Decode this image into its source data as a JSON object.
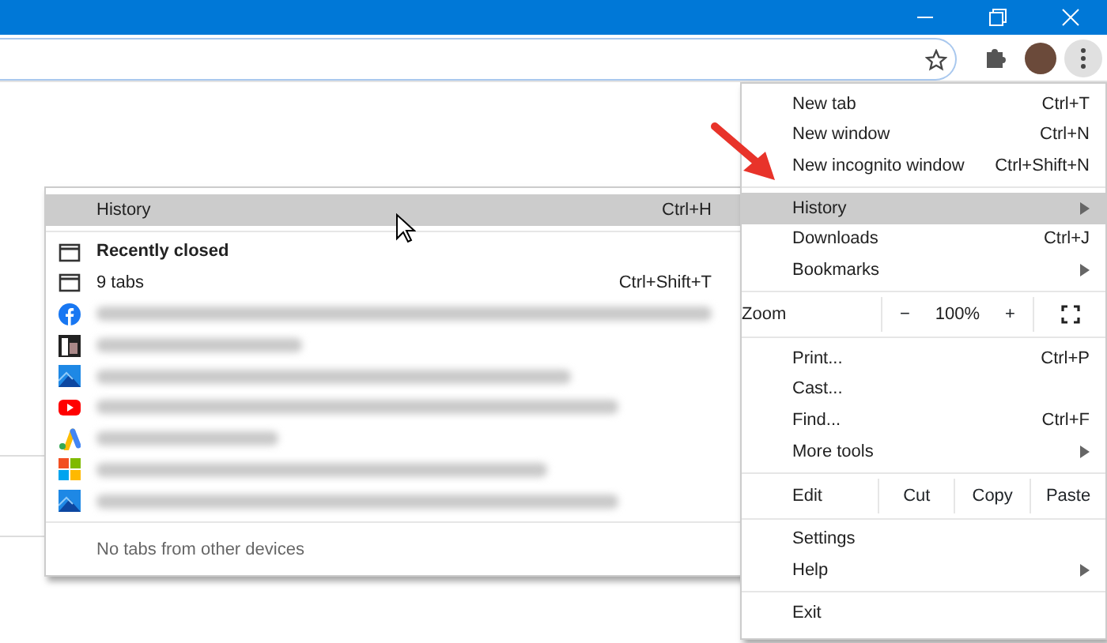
{
  "main_menu": {
    "groups": [
      [
        {
          "kind": "item",
          "label": "New tab",
          "shortcut": "Ctrl+T",
          "has_submenu": false,
          "selected": false
        },
        {
          "kind": "item",
          "label": "New window",
          "shortcut": "Ctrl+N",
          "has_submenu": false,
          "selected": false
        },
        {
          "kind": "item",
          "label": "New incognito window",
          "shortcut": "Ctrl+Shift+N",
          "has_submenu": false,
          "selected": false
        }
      ],
      [
        {
          "kind": "item",
          "label": "History",
          "has_submenu": true,
          "selected": true
        },
        {
          "kind": "item",
          "label": "Downloads",
          "shortcut": "Ctrl+J",
          "has_submenu": false,
          "selected": false
        },
        {
          "kind": "item",
          "label": "Bookmarks",
          "has_submenu": true,
          "selected": false
        }
      ],
      [
        {
          "kind": "zoom",
          "label": "Zoom",
          "minus": "−",
          "value": "100%",
          "plus": "+"
        }
      ],
      [
        {
          "kind": "item",
          "label": "Print...",
          "shortcut": "Ctrl+P",
          "has_submenu": false,
          "selected": false
        },
        {
          "kind": "item",
          "label": "Cast...",
          "has_submenu": false,
          "selected": false
        },
        {
          "kind": "item",
          "label": "Find...",
          "shortcut": "Ctrl+F",
          "has_submenu": false,
          "selected": false
        },
        {
          "kind": "item",
          "label": "More tools",
          "has_submenu": true,
          "selected": false
        }
      ],
      [
        {
          "kind": "edit",
          "label": "Edit",
          "buttons": [
            "Cut",
            "Copy",
            "Paste"
          ]
        }
      ],
      [
        {
          "kind": "item",
          "label": "Settings",
          "has_submenu": false,
          "selected": false
        },
        {
          "kind": "item",
          "label": "Help",
          "has_submenu": true,
          "selected": false
        }
      ],
      [
        {
          "kind": "item",
          "label": "Exit",
          "has_submenu": false,
          "selected": false
        }
      ]
    ]
  },
  "history_submenu": {
    "header": {
      "label": "History",
      "shortcut": "Ctrl+H",
      "selected": true
    },
    "recently_closed": "Recently closed",
    "entries": [
      {
        "kind": "window",
        "label": "9 tabs",
        "shortcut": "Ctrl+Shift+T"
      },
      {
        "kind": "facebook"
      },
      {
        "kind": "book"
      },
      {
        "kind": "edge-dev"
      },
      {
        "kind": "youtube"
      },
      {
        "kind": "ads"
      },
      {
        "kind": "windows"
      },
      {
        "kind": "edge-dev"
      }
    ],
    "footer": "No tabs from other devices"
  }
}
